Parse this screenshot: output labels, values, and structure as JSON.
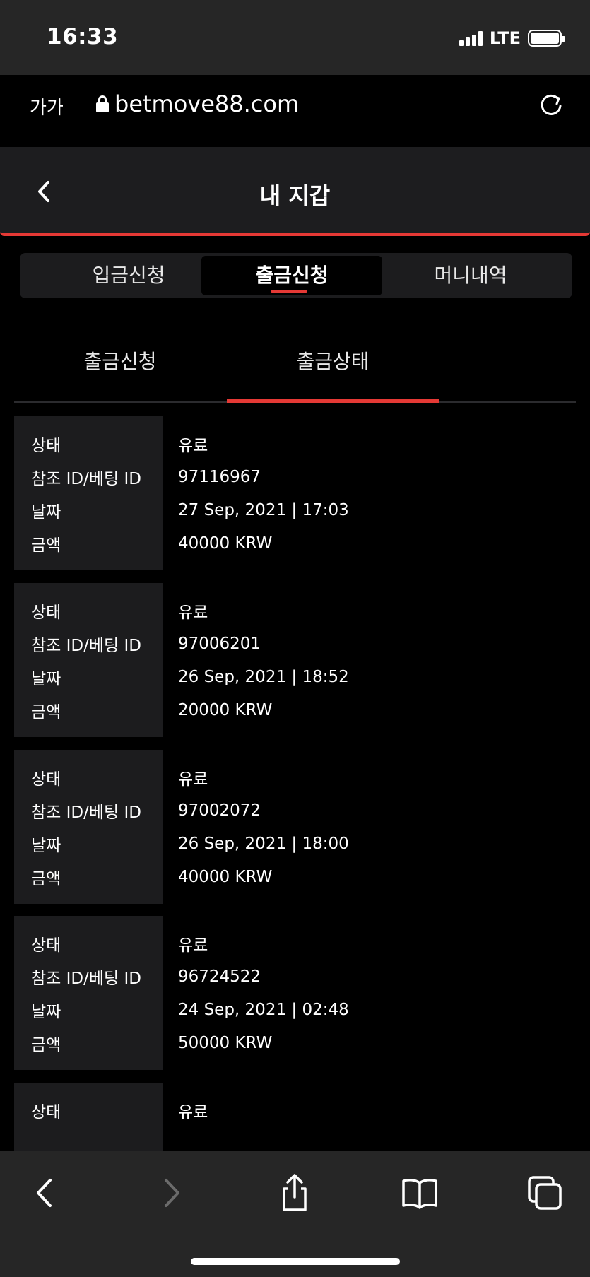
{
  "status_bar": {
    "time": "16:33",
    "network": "LTE"
  },
  "browser": {
    "text_size_label": "가가",
    "url": "betmove88.com"
  },
  "header": {
    "title": "내 지갑"
  },
  "main_tabs": [
    {
      "label": "입금신청"
    },
    {
      "label": "출금신청"
    },
    {
      "label": "머니내역"
    }
  ],
  "active_main_tab": "출금신청",
  "sub_tabs": [
    {
      "label": "출금신청"
    },
    {
      "label": "출금상태"
    }
  ],
  "active_sub_tab": "출금상태",
  "records": [
    {
      "status_label": "상태",
      "status": "유료",
      "ref_label": "참조 ID/베팅 ID",
      "ref": "97116967",
      "date_label": "날짜",
      "date": "27 Sep, 2021 | 17:03",
      "amount_label": "금액",
      "amount": "40000 KRW"
    },
    {
      "status_label": "상태",
      "status": "유료",
      "ref_label": "참조 ID/베팅 ID",
      "ref": "97006201",
      "date_label": "날짜",
      "date": "26 Sep, 2021 | 18:52",
      "amount_label": "금액",
      "amount": "20000 KRW"
    },
    {
      "status_label": "상태",
      "status": "유료",
      "ref_label": "참조 ID/베팅 ID",
      "ref": "97002072",
      "date_label": "날짜",
      "date": "26 Sep, 2021 | 18:00",
      "amount_label": "금액",
      "amount": "40000 KRW"
    },
    {
      "status_label": "상태",
      "status": "유료",
      "ref_label": "참조 ID/베팅 ID",
      "ref": "96724522",
      "date_label": "날짜",
      "date": "24 Sep, 2021 | 02:48",
      "amount_label": "금액",
      "amount": "50000 KRW"
    },
    {
      "status_label": "상태",
      "status": "유료"
    }
  ],
  "colors": {
    "accent": "#e53935",
    "panel": "#1c1c1e",
    "background": "#000000",
    "chrome": "#262626"
  },
  "toolbar": {
    "icons": [
      "back-icon",
      "forward-icon",
      "share-icon",
      "bookmarks-icon",
      "tabs-icon"
    ]
  }
}
